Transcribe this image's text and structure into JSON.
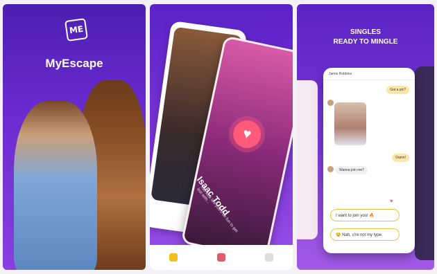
{
  "panel1": {
    "logo_text": "ME",
    "app_name": "MyEscape"
  },
  "panel2": {
    "card_name": "Isaac Todd",
    "card_quote": "You look like you'd be fun to get lost with..."
  },
  "panel3": {
    "headline_line1": "SINGLES",
    "headline_line2": "READY TO MINGLE",
    "chat_contact": "Jamie Robbins",
    "msg_get_pic": "Got a pic?",
    "msg_damn": "Damn!",
    "msg_wanna_join": "Wanna join me?",
    "option_1": "I want to join you! 🔥",
    "option_2": "😒 Nah, u're not my type."
  }
}
